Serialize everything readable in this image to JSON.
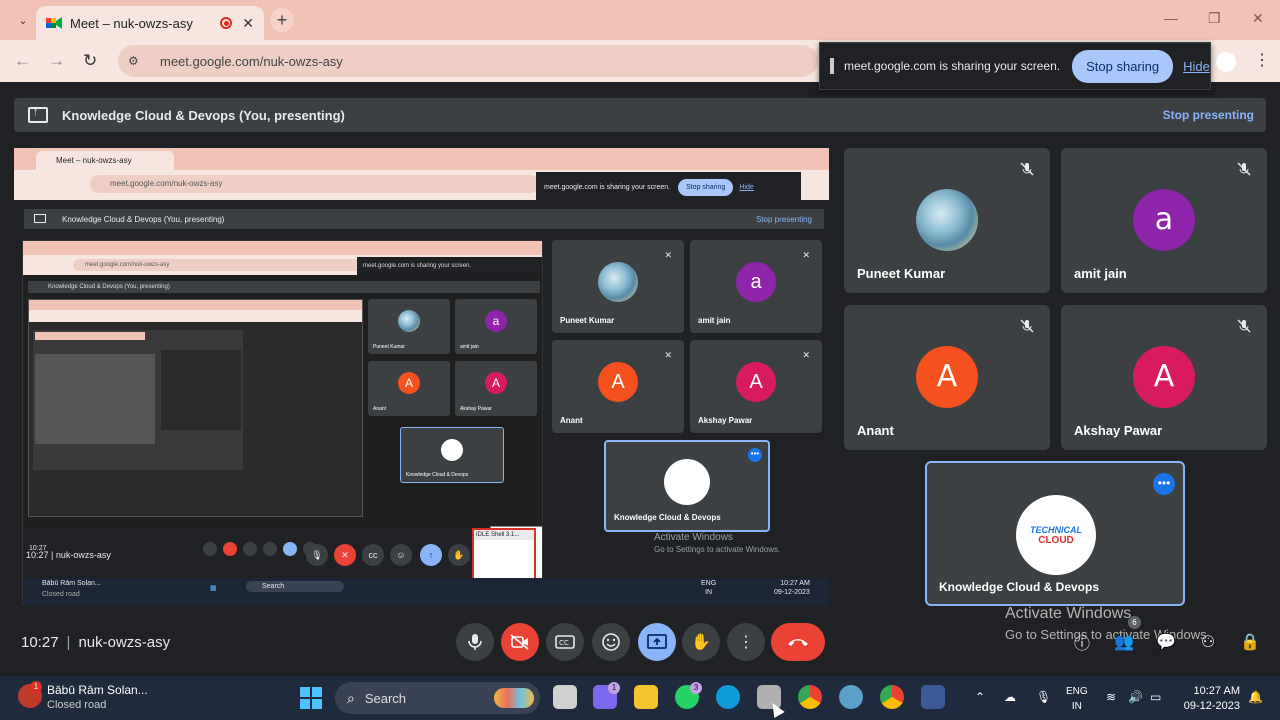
{
  "browser": {
    "tab_title": "Meet – nuk-owzs-asy",
    "tab_close": "✕",
    "new_tab": "+",
    "url": "meet.google.com/nuk-owzs-asy",
    "win_min": "—",
    "win_max": "❐",
    "win_close": "✕"
  },
  "share_notice": {
    "message": "meet.google.com is sharing your screen.",
    "stop_label": "Stop sharing",
    "hide_label": "Hide"
  },
  "presenting": {
    "title": "Knowledge Cloud & Devops (You, presenting)",
    "stop_label": "Stop presenting"
  },
  "shared_screen": {
    "tab_title": "Meet – nuk-owzs-asy",
    "url": "meet.google.com/nuk-owzs-asy",
    "share_message": "meet.google.com is sharing your screen.",
    "stop_sharing": "Stop sharing",
    "hide": "Hide",
    "present_title": "Knowledge Cloud & Devops (You, presenting)",
    "stop_presenting": "Stop presenting",
    "tiles": [
      {
        "name": "Puneet Kumar"
      },
      {
        "name": "amit jain",
        "initial": "a"
      },
      {
        "name": "Anant",
        "initial": "A"
      },
      {
        "name": "Akshay Pawar",
        "initial": "A"
      },
      {
        "name": "Knowledge Cloud & Devops"
      }
    ],
    "clock": "10:27",
    "meeting_code": "nuk-owzs-asy",
    "idle_title": "IDLE Shell 3.1...",
    "activate_line1": "Activate Windows",
    "activate_line2": "Go to Settings to activate Windows.",
    "taskbar_user": "Bābū Rām Solan...",
    "taskbar_status": "Closed road",
    "search": "Search",
    "lang1": "ENG",
    "lang2": "IN",
    "time": "10:27 AM",
    "date": "09-12-2023"
  },
  "participants": [
    {
      "name": "Puneet Kumar",
      "avatar": "photo"
    },
    {
      "name": "amit jain",
      "initial": "a",
      "color": "#8e24aa"
    },
    {
      "name": "Anant",
      "initial": "A",
      "color": "#f4511e"
    },
    {
      "name": "Akshay Pawar",
      "initial": "A",
      "color": "#d81b60"
    }
  ],
  "presenter_tile": {
    "name": "Knowledge Cloud & Devops",
    "logo_line1": "TECHNICAL",
    "logo_line2": "CLOUD",
    "more": "•••"
  },
  "meeting": {
    "clock": "10:27",
    "separator": "|",
    "code": "nuk-owzs-asy"
  },
  "activate": {
    "line1": "Activate Windows",
    "line2": "Go to Settings to activate Windows."
  },
  "people_count": "6",
  "taskbar": {
    "user": "Bābū Rām Solan...",
    "status": "Closed road",
    "notif_count": "1",
    "search": "Search",
    "teams_badge": "1",
    "whatsapp_badge": "3",
    "lang1": "ENG",
    "lang2": "IN",
    "time": "10:27 AM",
    "date": "09-12-2023"
  },
  "colors": {
    "accent": "#8ab4f8",
    "danger": "#ea4335",
    "tile_bg": "#3c4043",
    "page_bg": "#202124"
  }
}
